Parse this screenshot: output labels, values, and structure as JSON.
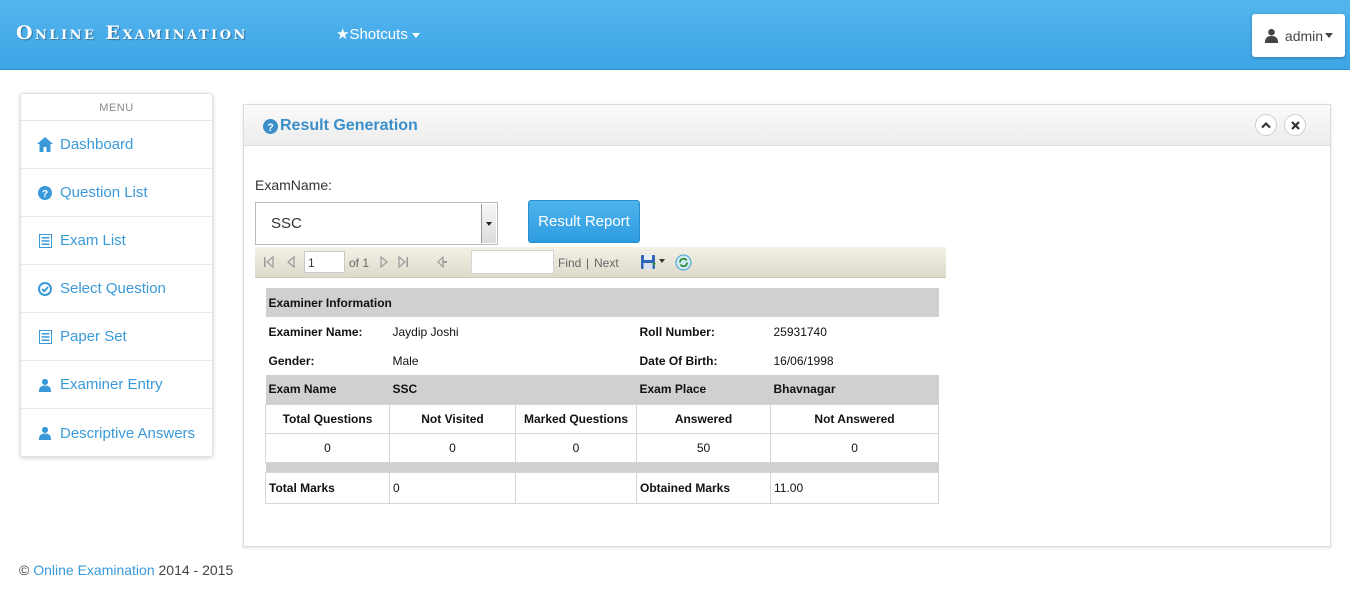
{
  "navbar": {
    "brand": "Online Examination",
    "shortcuts_label": "★Shotcuts",
    "user_label": "admin"
  },
  "sidebar": {
    "heading": "MENU",
    "items": [
      {
        "label": "Dashboard",
        "icon": "home-icon"
      },
      {
        "label": "Question List",
        "icon": "question-circle-icon"
      },
      {
        "label": "Exam List",
        "icon": "list-icon"
      },
      {
        "label": "Select Question",
        "icon": "check-circle-icon"
      },
      {
        "label": "Paper Set",
        "icon": "list-icon"
      },
      {
        "label": "Examiner Entry",
        "icon": "user-icon"
      },
      {
        "label": "Descriptive Answers",
        "icon": "user-icon"
      }
    ]
  },
  "panel": {
    "title": "Result Generation",
    "exam_label": "ExamName:",
    "exam_selected": "SSC",
    "report_button": "Result Report"
  },
  "toolbar": {
    "page_value": "1",
    "of_text": "of 1",
    "find": "Find",
    "separator": "|",
    "next": "Next"
  },
  "report": {
    "section_title": "Examiner Information",
    "examiner_name_label": "Examiner Name:",
    "examiner_name": "Jaydip Joshi",
    "roll_label": "Roll Number:",
    "roll": "25931740",
    "gender_label": "Gender:",
    "gender": "Male",
    "dob_label": "Date Of Birth:",
    "dob": "16/06/1998",
    "exam_name_label": "Exam Name",
    "exam_name": "SSC",
    "exam_place_label": "Exam Place",
    "exam_place": "Bhavnagar",
    "stats_headers": [
      "Total Questions",
      "Not Visited",
      "Marked Questions",
      "Answered",
      "Not Answered"
    ],
    "stats_values": [
      "0",
      "0",
      "0",
      "50",
      "0"
    ],
    "total_marks_label": "Total Marks",
    "total_marks": "0",
    "obtained_label": "Obtained Marks",
    "obtained": "11.00"
  },
  "footer": {
    "copyright": "©",
    "link": "Online Examination",
    "years": "2014 - 2015"
  }
}
